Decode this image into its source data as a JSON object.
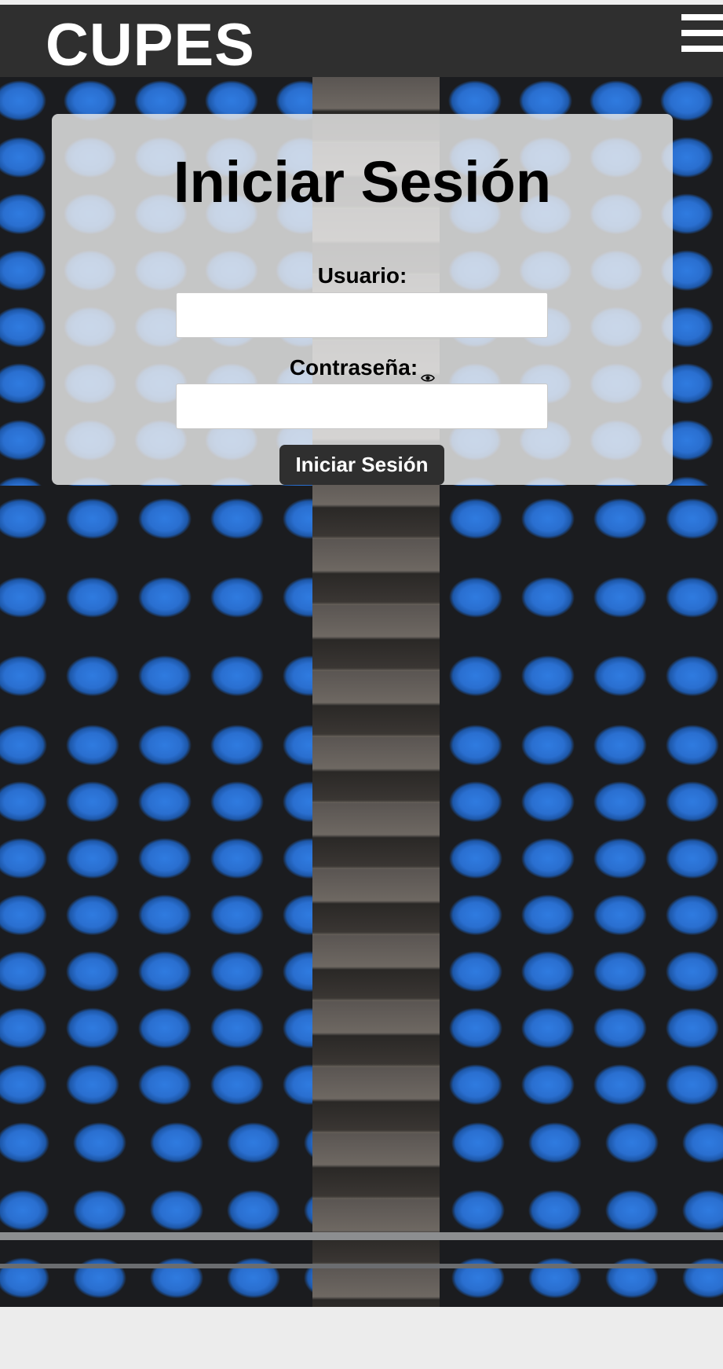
{
  "header": {
    "brand": "CUPES",
    "menu_icon": "hamburger-menu-icon",
    "background_color": "#2f2f2f"
  },
  "login": {
    "title": "Iniciar Sesión",
    "username_label": "Usuario:",
    "username_value": "",
    "password_label": "Contraseña:",
    "password_value": "",
    "password_toggle_icon": "eye-icon",
    "submit_label": "Iniciar Sesión",
    "button_color": "#2f2f2f"
  },
  "background": {
    "image": "stadium-blue-seats",
    "seat_color": "#2a6fd0"
  }
}
